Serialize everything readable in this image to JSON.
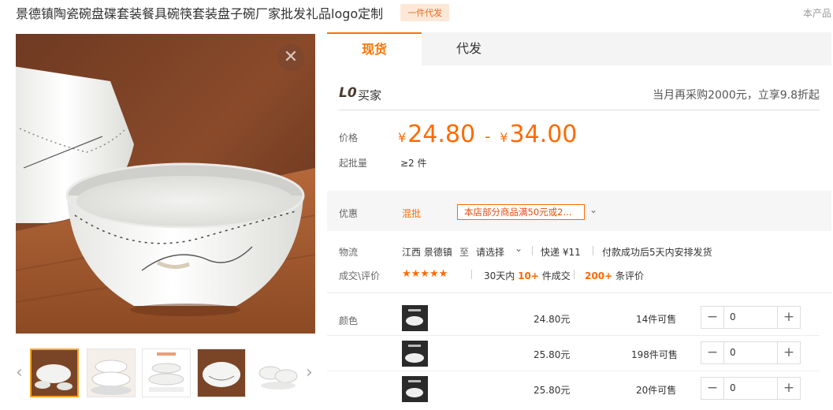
{
  "header": {
    "title": "景德镇陶瓷碗盘碟套装餐具碗筷套装盘子碗厂家批发礼品logo定制",
    "tag": "一件代发",
    "corner_note": "本产品"
  },
  "gallery": {
    "close": "✕",
    "prev": "‹",
    "next": "›"
  },
  "tabs": [
    {
      "label": "现货"
    },
    {
      "label": "代发"
    }
  ],
  "buyer": {
    "level": "L0",
    "label": "买家",
    "promo": "当月再采购2000元，立享9.8折起"
  },
  "price": {
    "label": "价格",
    "currency": "¥",
    "low": "24.80",
    "dash": "-",
    "high": "34.00",
    "moq_label": "起批量",
    "moq_value": "≥2 件"
  },
  "discount": {
    "label": "优惠",
    "mix": "混批",
    "coupon": "本店部分商品满50元或2...",
    "chevron": "⌄"
  },
  "logistics": {
    "label": "物流",
    "origin": "江西 景德镇",
    "to": "至",
    "dest": "请选择",
    "chevron": "⌄",
    "express": "快递 ¥11",
    "ship_note": "付款成功后5天内安排发货"
  },
  "reviews": {
    "label": "成交\\评价",
    "stars": "★★★★★",
    "sold_prefix": "30天内",
    "sold_count": "10+",
    "sold_suffix": "件成交",
    "review_count": "200+",
    "review_suffix": "条评价",
    "rating": 4.5
  },
  "sku": {
    "label": "颜色",
    "rows": [
      {
        "price": "24.80元",
        "stock": "14件可售",
        "qty": "0"
      },
      {
        "price": "25.80元",
        "stock": "198件可售",
        "qty": "0"
      },
      {
        "price": "25.80元",
        "stock": "20件可售",
        "qty": "0"
      }
    ],
    "minus": "−",
    "plus": "+"
  },
  "colors": {
    "accent": "#ff6a00",
    "tab_active": "#ff7300",
    "tag_bg": "#fde8d8"
  }
}
